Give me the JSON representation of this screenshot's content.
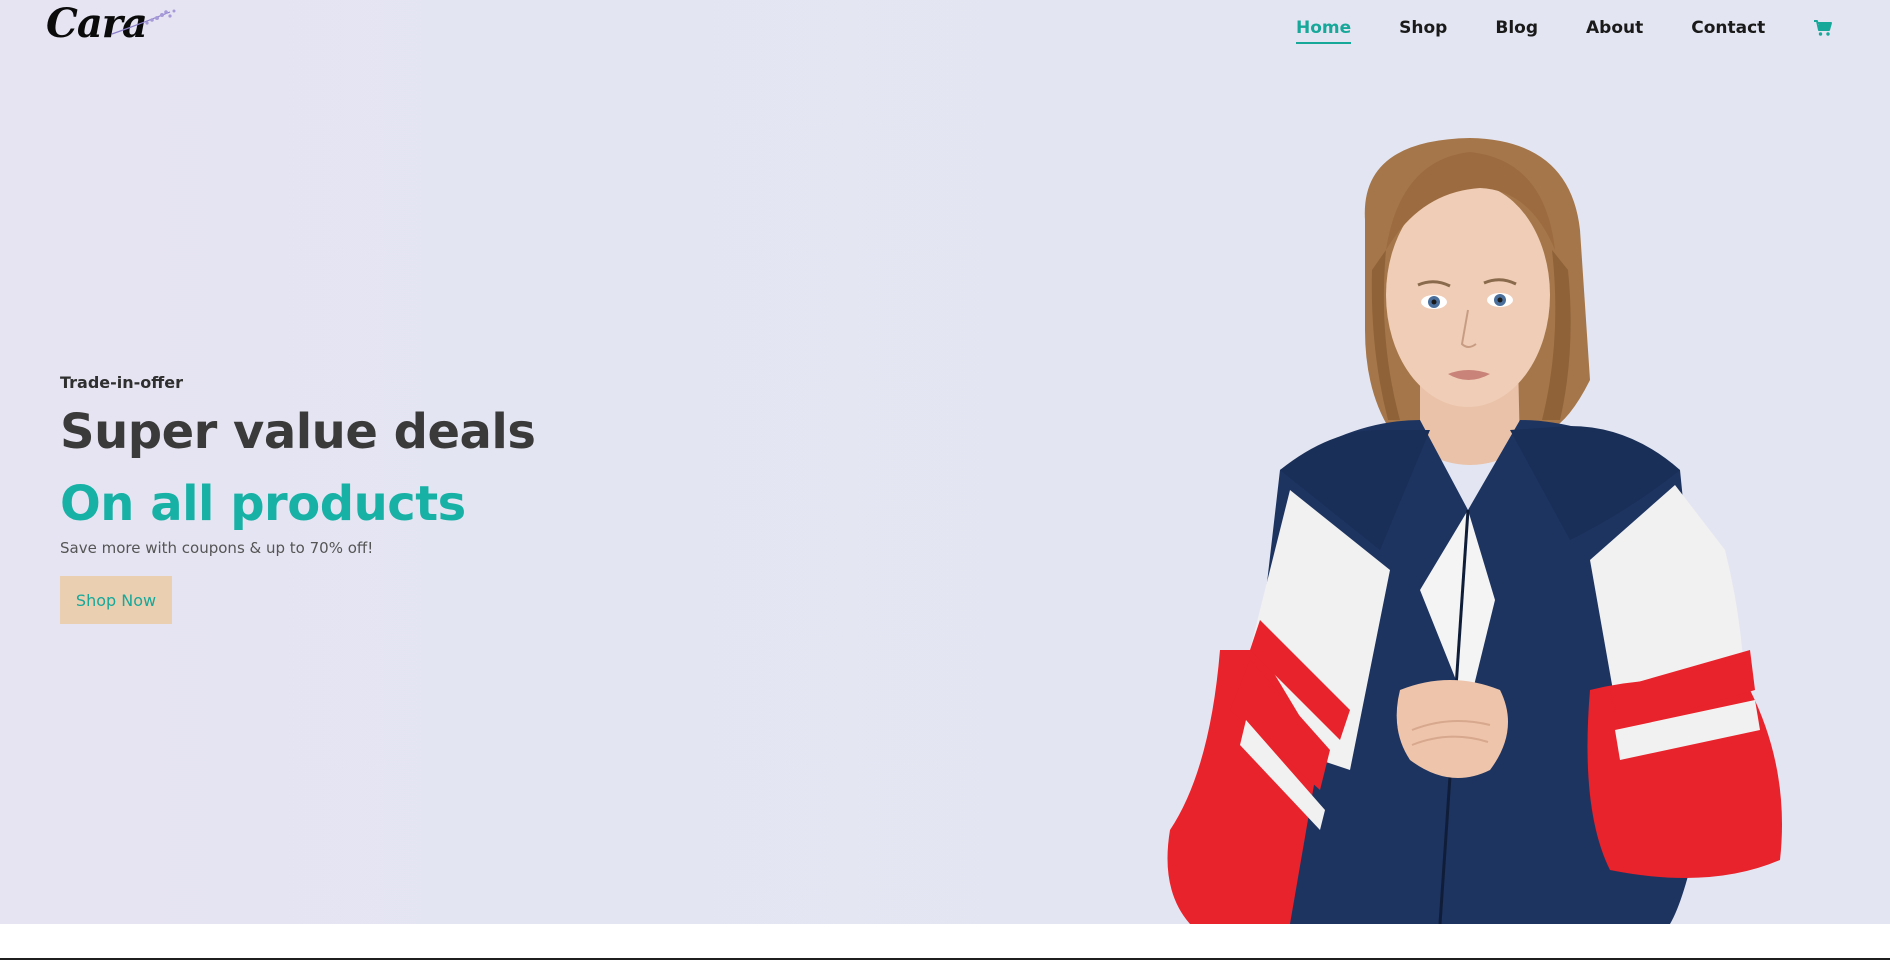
{
  "brand": {
    "logo_text": "Cara",
    "logo_accent_color": "#8b7fc9"
  },
  "nav": {
    "items": [
      {
        "label": "Home",
        "active": true
      },
      {
        "label": "Shop",
        "active": false
      },
      {
        "label": "Blog",
        "active": false
      },
      {
        "label": "About",
        "active": false
      },
      {
        "label": "Contact",
        "active": false
      }
    ],
    "cart_icon": "cart-icon"
  },
  "hero": {
    "eyebrow": "Trade-in-offer",
    "headline": "Super value deals",
    "subheadline": "On all products",
    "tagline": "Save more with coupons & up to 70% off!",
    "cta_label": "Shop Now",
    "image": "model-in-track-jacket"
  },
  "colors": {
    "accent": "#17b1a6",
    "nav_active": "#17a89a",
    "button_bg": "#ebcfb1",
    "hero_bg": "#e3e6f2",
    "jacket_navy": "#1d3461",
    "jacket_red": "#e8232b",
    "jacket_white": "#f1f1f1"
  }
}
